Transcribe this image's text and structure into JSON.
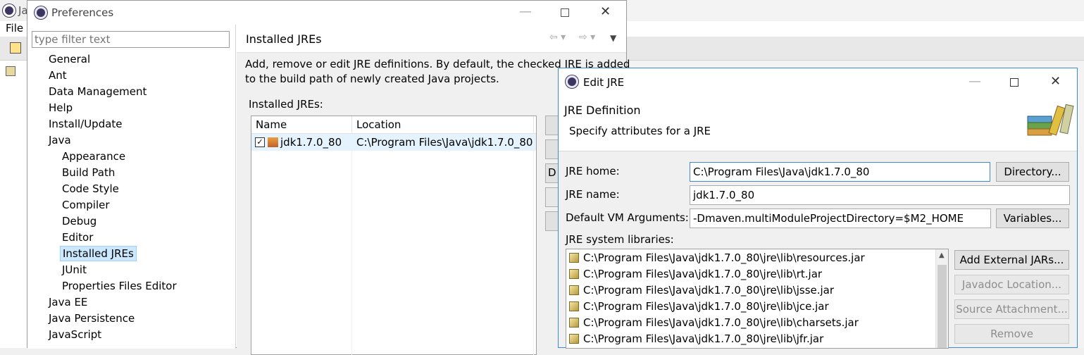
{
  "bg_window": {
    "title_partial": "Ja",
    "menu_file": "File"
  },
  "preferences": {
    "title": "Preferences",
    "filter_placeholder": "type filter text",
    "tree": [
      {
        "label": "General",
        "level": 0
      },
      {
        "label": "Ant",
        "level": 0
      },
      {
        "label": "Data Management",
        "level": 0
      },
      {
        "label": "Help",
        "level": 0
      },
      {
        "label": "Install/Update",
        "level": 0
      },
      {
        "label": "Java",
        "level": 0
      },
      {
        "label": "Appearance",
        "level": 1
      },
      {
        "label": "Build Path",
        "level": 1
      },
      {
        "label": "Code Style",
        "level": 1
      },
      {
        "label": "Compiler",
        "level": 1
      },
      {
        "label": "Debug",
        "level": 1
      },
      {
        "label": "Editor",
        "level": 1
      },
      {
        "label": "Installed JREs",
        "level": 1,
        "selected": true
      },
      {
        "label": "JUnit",
        "level": 1
      },
      {
        "label": "Properties Files Editor",
        "level": 1
      },
      {
        "label": "Java EE",
        "level": 0
      },
      {
        "label": "Java Persistence",
        "level": 0
      },
      {
        "label": "JavaScript",
        "level": 0
      }
    ],
    "page_title": "Installed JREs",
    "description_line1": "Add, remove or edit JRE definitions. By default, the checked JRE is added",
    "description_line2": "to the build path of newly created Java projects.",
    "table_label": "Installed JREs:",
    "columns": [
      "Name",
      "Location"
    ],
    "rows": [
      {
        "name": "jdk1.7.0_80",
        "location": "C:\\Program Files\\Java\\jdk1.7.0_80",
        "checked": true
      }
    ],
    "side_button_partial": "D"
  },
  "edit_jre": {
    "title": "Edit JRE",
    "heading": "JRE Definition",
    "subheading": "Specify attributes for a JRE",
    "jre_home_label": "JRE home:",
    "jre_home_value": "C:\\Program Files\\Java\\jdk1.7.0_80",
    "directory_button": "Directory...",
    "jre_name_label": "JRE name:",
    "jre_name_value": "jdk1.7.0_80",
    "vm_args_label": "Default VM Arguments:",
    "vm_args_value": "-Dmaven.multiModuleProjectDirectory=$M2_HOME",
    "variables_button": "Variables...",
    "libraries_label": "JRE system libraries:",
    "libraries": [
      "C:\\Program Files\\Java\\jdk1.7.0_80\\jre\\lib\\resources.jar",
      "C:\\Program Files\\Java\\jdk1.7.0_80\\jre\\lib\\rt.jar",
      "C:\\Program Files\\Java\\jdk1.7.0_80\\jre\\lib\\jsse.jar",
      "C:\\Program Files\\Java\\jdk1.7.0_80\\jre\\lib\\jce.jar",
      "C:\\Program Files\\Java\\jdk1.7.0_80\\jre\\lib\\charsets.jar",
      "C:\\Program Files\\Java\\jdk1.7.0_80\\jre\\lib\\jfr.jar"
    ],
    "add_external_jars_button": "Add External JARs...",
    "javadoc_location_button": "Javadoc Location...",
    "source_attachment_button": "Source Attachment...",
    "remove_button": "Remove"
  },
  "colors": {
    "selection": "#cce8ff",
    "focus_border": "#3c8ad8"
  }
}
